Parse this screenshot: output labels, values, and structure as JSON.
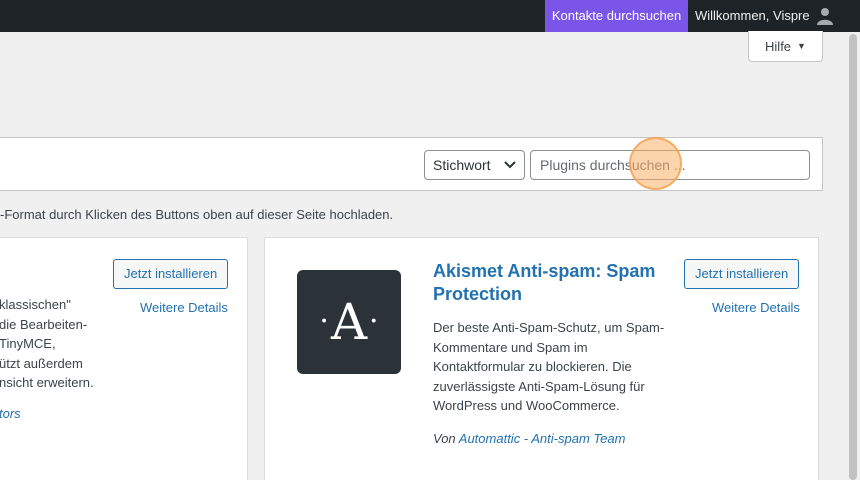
{
  "admin_bar": {
    "contacts_search": "Kontakte durchsuchen",
    "welcome": "Willkommen, Vispre",
    "avatar_icon": "user-icon"
  },
  "help": {
    "label": "Hilfe",
    "caret": "▼"
  },
  "filter": {
    "select_value": "Stichwort",
    "search_placeholder": "Plugins durchsuchen ..."
  },
  "upload_hint": "-Format durch Klicken des Buttons oben auf dieser Seite hochladen.",
  "cards": [
    {
      "install_label": "Jetzt installieren",
      "details_label": "Weitere Details",
      "desc_lines": [
        "klassischen\"",
        "die Bearbeiten-",
        "TinyMCE,",
        "ützt außerdem",
        "nsicht erweitern."
      ],
      "author_fragment": "tors"
    },
    {
      "icon_letter": "A",
      "icon_dot": "·",
      "title": "Akismet Anti-spam: Spam Protection",
      "install_label": "Jetzt installieren",
      "details_label": "Weitere Details",
      "description": "Der beste Anti-Spam-Schutz, um Spam-Kommentare und Spam im Kontaktformular zu blockieren. Die zuverlässigste Anti-Spam-Lösung für WordPress und WooCommerce.",
      "author_prefix": "Von",
      "author_name": "Automattic - Anti-spam Team"
    }
  ],
  "colors": {
    "admin_bar": "#1d2327",
    "accent_purple": "#7b55e8",
    "link_blue": "#2271b1",
    "icon_dark": "#2c3338"
  }
}
